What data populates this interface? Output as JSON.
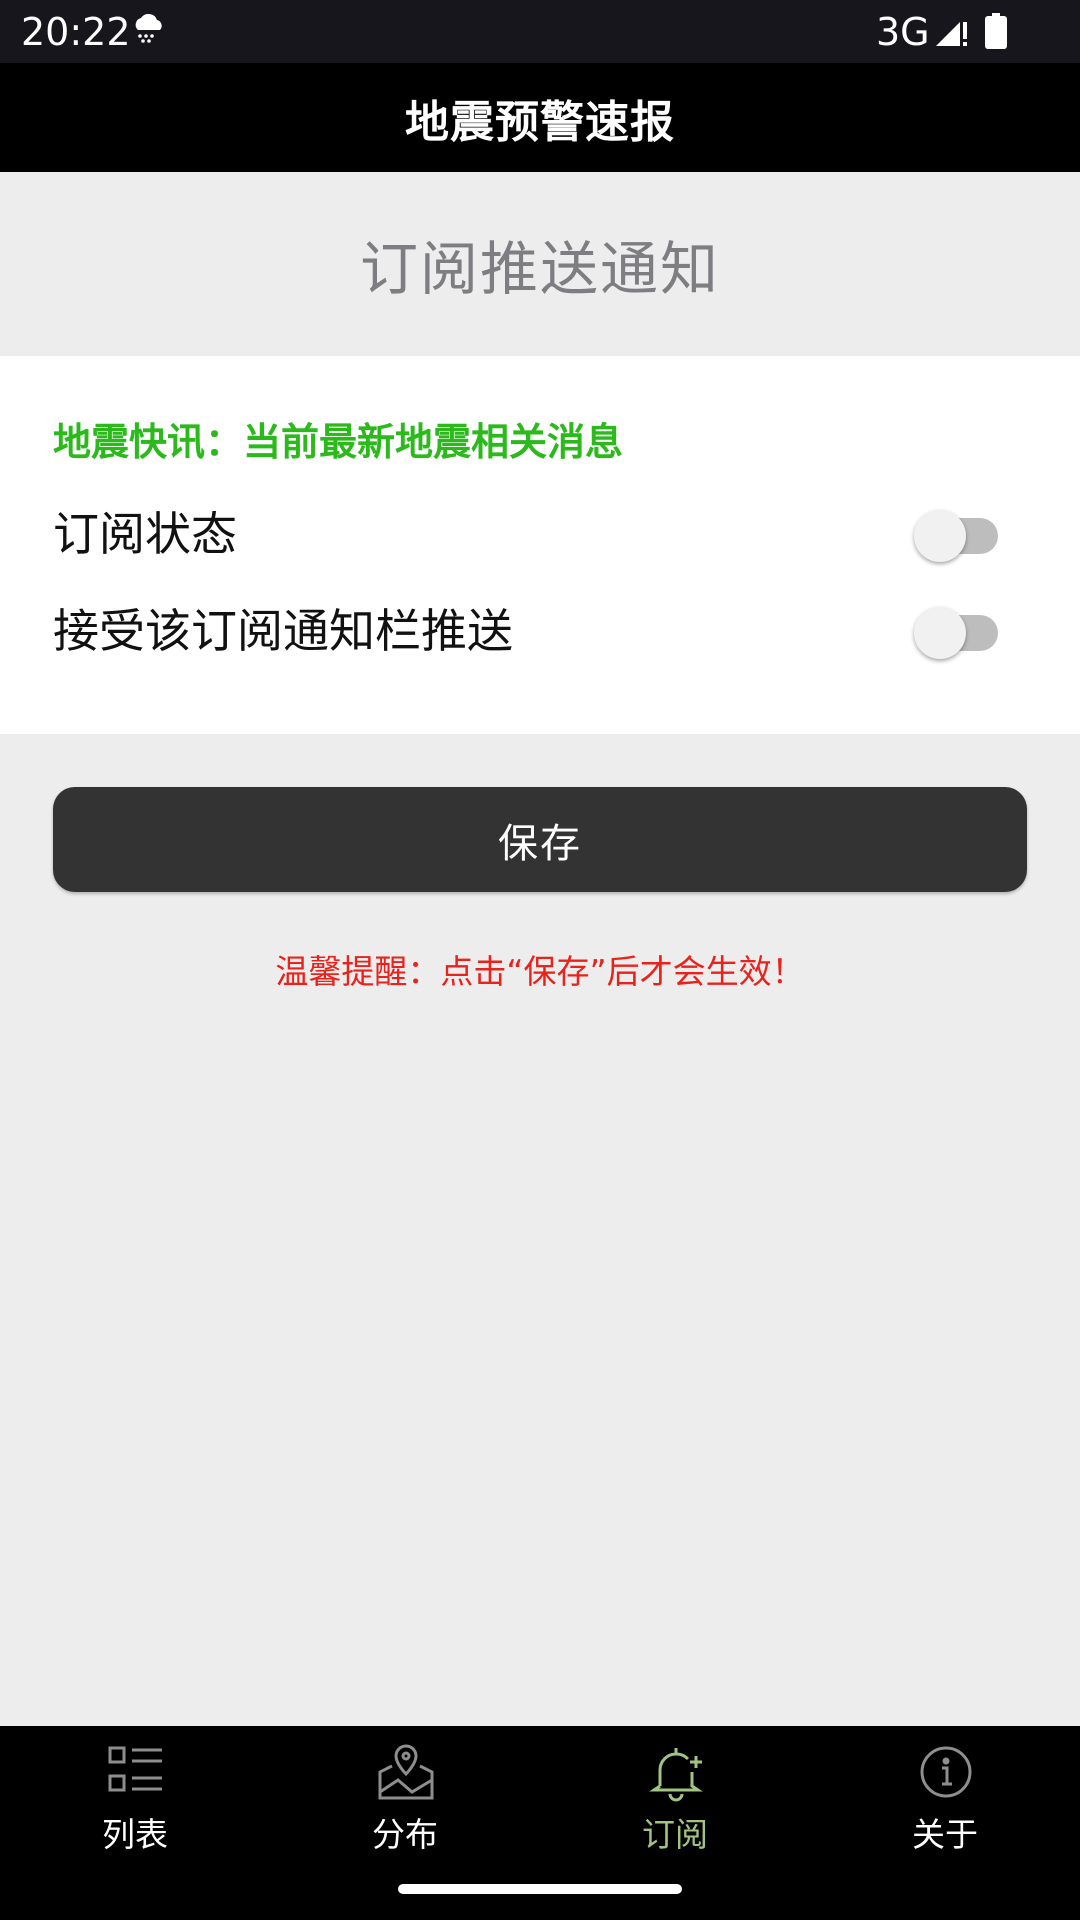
{
  "status_bar": {
    "time": "20:22",
    "weather_icon": "snow-cloud-icon",
    "network": "3G",
    "signal_icon": "signal-icon",
    "battery_icon": "battery-icon"
  },
  "app_bar": {
    "title": "地震预警速报"
  },
  "section": {
    "title": "订阅推送通知"
  },
  "card": {
    "topic_desc": "地震快讯：当前最新地震相关消息",
    "settings": [
      {
        "label": "订阅状态",
        "enabled": false
      },
      {
        "label": "接受该订阅通知栏推送",
        "enabled": false
      }
    ]
  },
  "save_label": "保存",
  "reminder": "温馨提醒：点击“保存”后才会生效！",
  "bottom_nav": {
    "items": [
      {
        "label": "列表",
        "icon": "list-icon"
      },
      {
        "label": "分布",
        "icon": "map-pin-icon"
      },
      {
        "label": "订阅",
        "icon": "bell-add-icon",
        "active": true
      },
      {
        "label": "关于",
        "icon": "info-icon"
      }
    ]
  },
  "colors": {
    "green_text": "#2bb91c",
    "red_text": "#e8231c",
    "active_tab": "#a3c382",
    "button_bg": "#333333"
  }
}
